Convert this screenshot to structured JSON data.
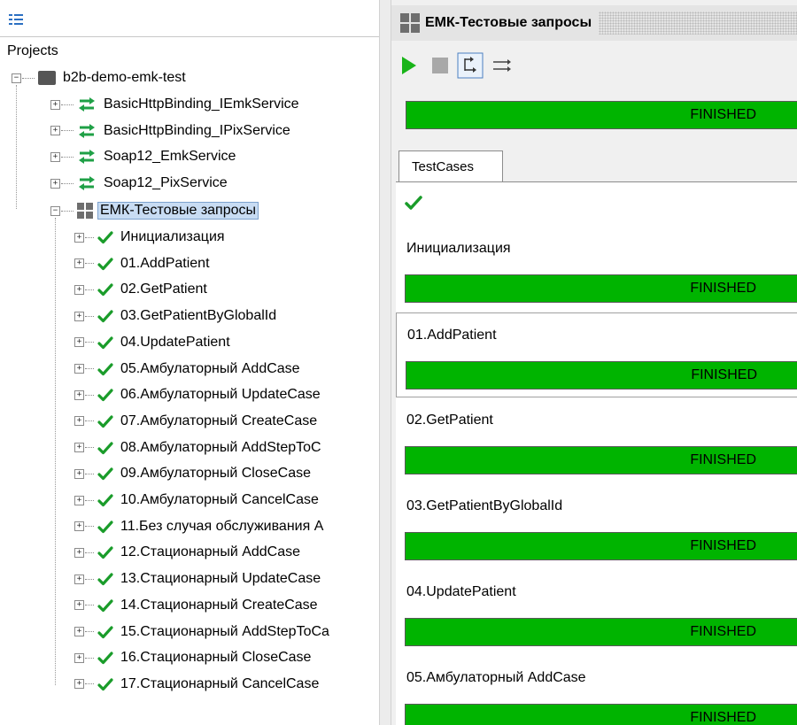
{
  "left": {
    "projects_label": "Projects",
    "project": {
      "label": "b2b-demo-emk-test"
    },
    "interfaces": [
      {
        "label": "BasicHttpBinding_IEmkService"
      },
      {
        "label": "BasicHttpBinding_IPixService"
      },
      {
        "label": "Soap12_EmkService"
      },
      {
        "label": "Soap12_PixService"
      }
    ],
    "suite": {
      "label": "ЕМК-Тестовые запросы"
    },
    "testcases": [
      {
        "label": "Инициализация"
      },
      {
        "label": "01.AddPatient"
      },
      {
        "label": "02.GetPatient"
      },
      {
        "label": "03.GetPatientByGlobalId"
      },
      {
        "label": "04.UpdatePatient"
      },
      {
        "label": "05.Амбулаторный AddCase"
      },
      {
        "label": "06.Амбулаторный UpdateCase"
      },
      {
        "label": "07.Амбулаторный CreateCase"
      },
      {
        "label": "08.Амбулаторный AddStepToC"
      },
      {
        "label": "09.Амбулаторный CloseCase"
      },
      {
        "label": "10.Амбулаторный CancelCase"
      },
      {
        "label": "11.Без случая обслуживания А"
      },
      {
        "label": "12.Стационарный AddCase"
      },
      {
        "label": "13.Стационарный UpdateCase"
      },
      {
        "label": "14.Стационарный CreateCase"
      },
      {
        "label": "15.Стационарный AddStepToCa"
      },
      {
        "label": "16.Стационарный CloseCase"
      },
      {
        "label": "17.Стационарный CancelCase"
      }
    ]
  },
  "right": {
    "title": "ЕМК-Тестовые запросы",
    "overall_status": "FINISHED",
    "overall_progress": 1.0,
    "tab_label": "TestCases",
    "results": [
      {
        "name": "Инициализация",
        "status": "FINISHED"
      },
      {
        "name": "01.AddPatient",
        "status": "FINISHED"
      },
      {
        "name": "02.GetPatient",
        "status": "FINISHED"
      },
      {
        "name": "03.GetPatientByGlobalId",
        "status": "FINISHED"
      },
      {
        "name": "04.UpdatePatient",
        "status": "FINISHED"
      },
      {
        "name": "05.Амбулаторный AddCase",
        "status": "FINISHED"
      }
    ]
  },
  "colors": {
    "progress_green": "#00b400",
    "check_green": "#1a9c2a",
    "selection": "#c8dcf3",
    "play_green": "#18b418"
  }
}
